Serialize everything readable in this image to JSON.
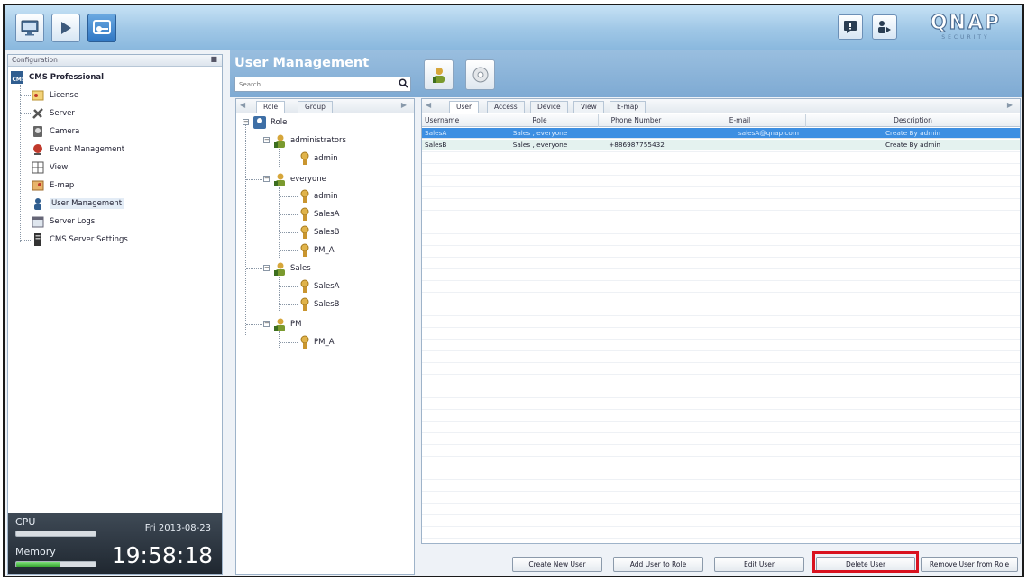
{
  "topbar": {
    "buttons": [
      "monitor-icon",
      "play-icon",
      "configuration-icon"
    ],
    "right_icons": [
      "message-icon",
      "user-logout-icon"
    ],
    "logo_text": "QNAP",
    "logo_sub": "SECURITY"
  },
  "left_panel": {
    "header": "Configuration",
    "root": "CMS Professional",
    "items": [
      {
        "label": "License",
        "icon": "license-icon"
      },
      {
        "label": "Server",
        "icon": "server-icon"
      },
      {
        "label": "Camera",
        "icon": "camera-icon"
      },
      {
        "label": "Event Management",
        "icon": "event-icon"
      },
      {
        "label": "View",
        "icon": "view-icon"
      },
      {
        "label": "E-map",
        "icon": "emap-icon"
      },
      {
        "label": "User Management",
        "icon": "user-management-icon",
        "selected": true
      },
      {
        "label": "Server Logs",
        "icon": "server-logs-icon"
      },
      {
        "label": "CMS Server Settings",
        "icon": "server-settings-icon"
      }
    ]
  },
  "status": {
    "cpu_label": "CPU",
    "memory_label": "Memory",
    "date": "Fri 2013-08-23",
    "time": "19:58:18",
    "cpu_usage": 0.0,
    "memory_usage": 0.55
  },
  "user_management": {
    "title": "User Management",
    "search_placeholder": "Search",
    "toolbar_icons": [
      "user-role-icon",
      "settings-disc-icon"
    ]
  },
  "role_panel": {
    "tabs": [
      "Role",
      "Group"
    ],
    "root": "Role",
    "groups": [
      {
        "name": "administrators",
        "members": [
          "admin"
        ]
      },
      {
        "name": "everyone",
        "members": [
          "admin",
          "SalesA",
          "SalesB",
          "PM_A"
        ]
      },
      {
        "name": "Sales",
        "members": [
          "SalesA",
          "SalesB"
        ]
      },
      {
        "name": "PM",
        "members": [
          "PM_A"
        ]
      }
    ]
  },
  "user_panel": {
    "tabs": [
      "User",
      "Access",
      "Device",
      "View",
      "E-map"
    ],
    "columns": [
      "Username",
      "Role",
      "Phone Number",
      "E-mail",
      "Description"
    ],
    "rows": [
      {
        "username": "SalesA",
        "role": "Sales , everyone",
        "phone": "",
        "email": "salesA@qnap.com",
        "description": "Create By admin",
        "selected": true
      },
      {
        "username": "SalesB",
        "role": "Sales , everyone",
        "phone": "+886987755432",
        "email": "",
        "description": "Create By admin",
        "selected": false
      }
    ]
  },
  "actions": {
    "create_new_user": "Create New User",
    "add_user_to_role": "Add User to Role",
    "edit_user": "Edit User",
    "delete_user": "Delete User",
    "remove_user_from_role": "Remove User from Role"
  },
  "colors": {
    "highlight_outline": "#d9121f",
    "selected_row": "#3d8fe2",
    "alt_row": "#e4f2ef"
  }
}
